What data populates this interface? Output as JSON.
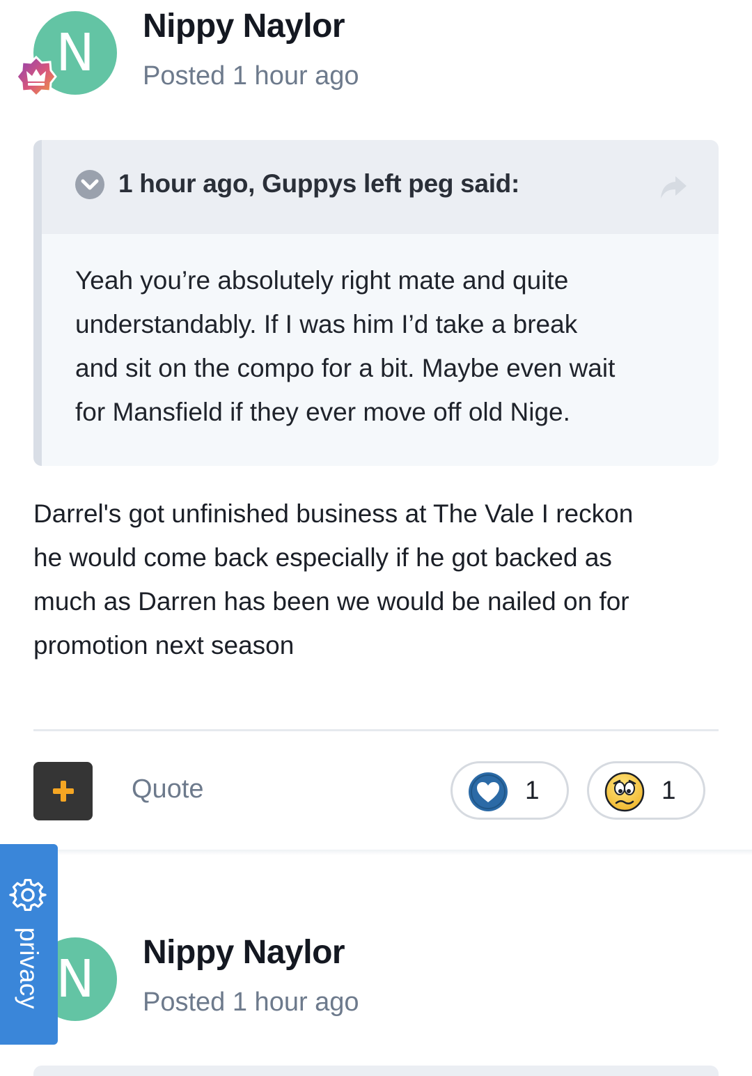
{
  "posts": [
    {
      "avatar_initial": "N",
      "author": "Nippy Naylor",
      "posted": "Posted 1 hour ago",
      "quote": {
        "header": "1 hour ago, Guppys left peg said:",
        "lines": [
          "Yeah you’re absolutely right mate and quite",
          "understandably. If I was him I’d take a break",
          "and sit on the compo for a bit. Maybe even wait",
          "for Mansfield if they ever move off old Nige."
        ]
      },
      "body_lines": [
        "Darrel's got unfinished business at The Vale I reckon",
        "he would come back especially if he got backed as",
        "much as Darren has been we would be nailed on for",
        "promotion next season"
      ],
      "actions": {
        "quote_label": "Quote",
        "reactions": [
          {
            "icon": "heart-like-icon",
            "count": "1"
          },
          {
            "icon": "sad-face-icon",
            "count": "1"
          }
        ]
      }
    },
    {
      "avatar_initial": "N",
      "author": "Nippy Naylor",
      "posted": "Posted 1 hour ago"
    }
  ],
  "privacy": {
    "label": "privacy",
    "icon": "gear-icon"
  },
  "colors": {
    "avatar": "#63c4a4",
    "privacy_tab": "#3a86d9",
    "plus_button": "#353535",
    "plus_icon": "#f5a623",
    "like": "#2b6aa6",
    "muted_text": "#6d7a8c"
  }
}
